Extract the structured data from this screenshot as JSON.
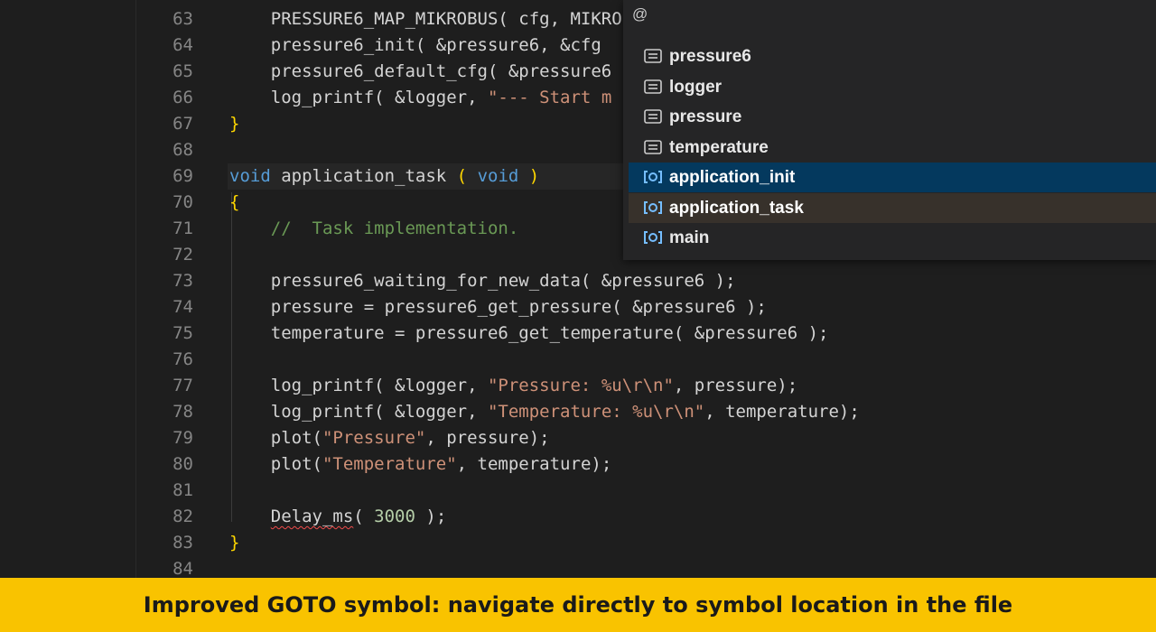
{
  "editor": {
    "lines": [
      {
        "n": "63",
        "tokens": [
          {
            "t": "    PRESSURE6_MAP_MIKROBUS( cfg, MIKRO",
            "c": ""
          }
        ]
      },
      {
        "n": "64",
        "tokens": [
          {
            "t": "    pressure6_init( &pressure6, &cfg",
            "c": ""
          }
        ]
      },
      {
        "n": "65",
        "tokens": [
          {
            "t": "    pressure6_default_cfg( &pressure6",
            "c": ""
          }
        ]
      },
      {
        "n": "66",
        "tokens": [
          {
            "t": "    log_printf( &logger, ",
            "c": ""
          },
          {
            "t": "\"--- Start m",
            "c": "str"
          }
        ]
      },
      {
        "n": "67",
        "tokens": [
          {
            "t": "}",
            "c": "br"
          }
        ]
      },
      {
        "n": "68",
        "tokens": []
      },
      {
        "n": "69",
        "cur": true,
        "tokens": [
          {
            "t": "void",
            "c": "kw"
          },
          {
            "t": " application_task ",
            "c": ""
          },
          {
            "t": "(",
            "c": "br"
          },
          {
            "t": " ",
            "c": ""
          },
          {
            "t": "void",
            "c": "kw"
          },
          {
            "t": " ",
            "c": ""
          },
          {
            "t": ")",
            "c": "br"
          }
        ]
      },
      {
        "n": "70",
        "tokens": [
          {
            "t": "{",
            "c": "br"
          }
        ]
      },
      {
        "n": "71",
        "tokens": [
          {
            "t": "    ",
            "c": ""
          },
          {
            "t": "//  Task implementation.",
            "c": "cmt"
          }
        ]
      },
      {
        "n": "72",
        "tokens": []
      },
      {
        "n": "73",
        "tokens": [
          {
            "t": "    pressure6_waiting_for_new_data( &pressure6 );",
            "c": ""
          }
        ]
      },
      {
        "n": "74",
        "tokens": [
          {
            "t": "    pressure = pressure6_get_pressure( &pressure6 );",
            "c": ""
          }
        ]
      },
      {
        "n": "75",
        "tokens": [
          {
            "t": "    temperature = pressure6_get_temperature( &pressure6 );",
            "c": ""
          }
        ]
      },
      {
        "n": "76",
        "tokens": []
      },
      {
        "n": "77",
        "tokens": [
          {
            "t": "    log_printf( &logger, ",
            "c": ""
          },
          {
            "t": "\"Pressure: %u\\r\\n\"",
            "c": "str"
          },
          {
            "t": ", pressure);",
            "c": ""
          }
        ]
      },
      {
        "n": "78",
        "tokens": [
          {
            "t": "    log_printf( &logger, ",
            "c": ""
          },
          {
            "t": "\"Temperature: %u\\r\\n\"",
            "c": "str"
          },
          {
            "t": ", temperature);",
            "c": ""
          }
        ]
      },
      {
        "n": "79",
        "tokens": [
          {
            "t": "    plot(",
            "c": ""
          },
          {
            "t": "\"Pressure\"",
            "c": "str"
          },
          {
            "t": ", pressure);",
            "c": ""
          }
        ]
      },
      {
        "n": "80",
        "tokens": [
          {
            "t": "    plot(",
            "c": ""
          },
          {
            "t": "\"Temperature\"",
            "c": "str"
          },
          {
            "t": ", temperature);",
            "c": ""
          }
        ]
      },
      {
        "n": "81",
        "tokens": []
      },
      {
        "n": "82",
        "tokens": [
          {
            "t": "    ",
            "c": ""
          },
          {
            "t": "Delay_ms",
            "c": "squig"
          },
          {
            "t": "( ",
            "c": ""
          },
          {
            "t": "3000",
            "c": "num"
          },
          {
            "t": " );",
            "c": ""
          }
        ]
      },
      {
        "n": "83",
        "tokens": [
          {
            "t": "}",
            "c": "br"
          }
        ]
      },
      {
        "n": "84",
        "tokens": []
      }
    ]
  },
  "palette": {
    "input_value": "@",
    "items": [
      {
        "label": "pressure6",
        "icon": "variable-icon"
      },
      {
        "label": "logger",
        "icon": "variable-icon"
      },
      {
        "label": "pressure",
        "icon": "variable-icon"
      },
      {
        "label": "temperature",
        "icon": "variable-icon"
      },
      {
        "label": "application_init",
        "icon": "function-icon"
      },
      {
        "label": "application_task",
        "icon": "function-icon"
      },
      {
        "label": "main",
        "icon": "function-icon"
      }
    ],
    "selected_index": 4,
    "hovered_index": 5
  },
  "colors": {
    "editor_bg": "#1e1e1e",
    "keyword": "#569cd6",
    "string": "#ce9178",
    "comment": "#6a9955",
    "bracket": "#ffd700",
    "banner_bg": "#f9c300",
    "function_icon": "#75beff"
  },
  "banner": {
    "text": "Improved GOTO symbol: navigate directly to symbol location in the file"
  }
}
